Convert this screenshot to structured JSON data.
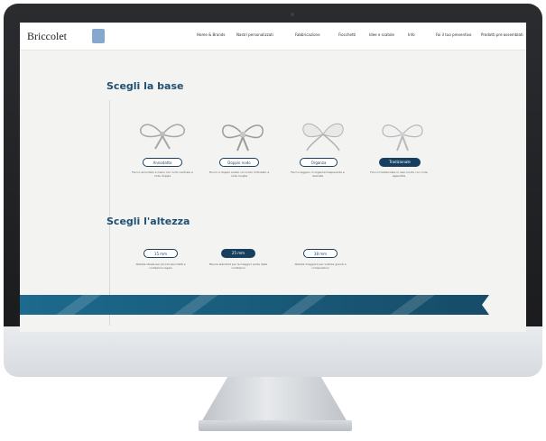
{
  "site": {
    "brand": "Briccolet",
    "nav": [
      "Home & Brands",
      "Nastri personalizzati",
      "Fabbricazione",
      "Fiocchetti",
      "Idee e scatole",
      "Info",
      "Fai il tuo preventivo",
      "Prodotti pre-assemblati"
    ]
  },
  "sections": {
    "base": {
      "title": "Scegli la base",
      "options": [
        {
          "label": "Annodatto",
          "desc": "Fiocco annodato a mano con nodo centrale e code doppie"
        },
        {
          "label": "Doppio nodo",
          "desc": "Fiocco a doppio anello con nodo rinforzato e code lunghe"
        },
        {
          "label": "Organza",
          "desc": "Fiocco leggero in organza trasparente e delicata"
        },
        {
          "label": "Tradizionale",
          "desc": "Fiocco tradizionale in raso lucido con code appuntite",
          "selected": true
        }
      ]
    },
    "height": {
      "title": "Scegli l'altezza",
      "options": [
        {
          "label": "15 mm",
          "desc": "Altezza ideale per piccoli pacchetti e confezioni regalo"
        },
        {
          "label": "25 mm",
          "desc": "Misura standard per la maggior parte delle confezioni",
          "selected": true
        },
        {
          "label": "38 mm",
          "desc": "Altezza maggiore per scatole grandi e composizioni"
        }
      ]
    }
  },
  "colors": {
    "accent": "#1f4f73",
    "pill_selected": "#163f5f",
    "banner": "#1c6a8e"
  }
}
